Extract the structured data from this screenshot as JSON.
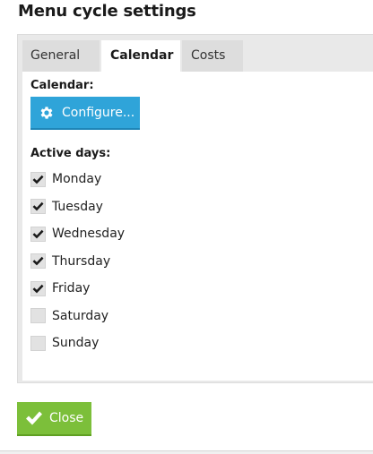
{
  "dialog": {
    "title": "Menu cycle settings"
  },
  "tabs": [
    {
      "label": "General",
      "selected": false
    },
    {
      "label": "Calendar",
      "selected": true
    },
    {
      "label": "Costs",
      "selected": false
    }
  ],
  "calendar": {
    "section_label": "Calendar:",
    "configure_button": {
      "label": "Configure...",
      "icon": "gear-icon"
    }
  },
  "active_days": {
    "section_label": "Active days:",
    "days": [
      {
        "label": "Monday",
        "checked": true
      },
      {
        "label": "Tuesday",
        "checked": true
      },
      {
        "label": "Wednesday",
        "checked": true
      },
      {
        "label": "Thursday",
        "checked": true
      },
      {
        "label": "Friday",
        "checked": true
      },
      {
        "label": "Saturday",
        "checked": false
      },
      {
        "label": "Sunday",
        "checked": false
      }
    ]
  },
  "footer": {
    "close_button": {
      "label": "Close",
      "icon": "checkmark-icon"
    }
  },
  "colors": {
    "primary_blue": "#2fa4d9",
    "success_green": "#7cbf3a",
    "tab_background": "#dddddd",
    "panel_background": "#e9e9e9"
  }
}
